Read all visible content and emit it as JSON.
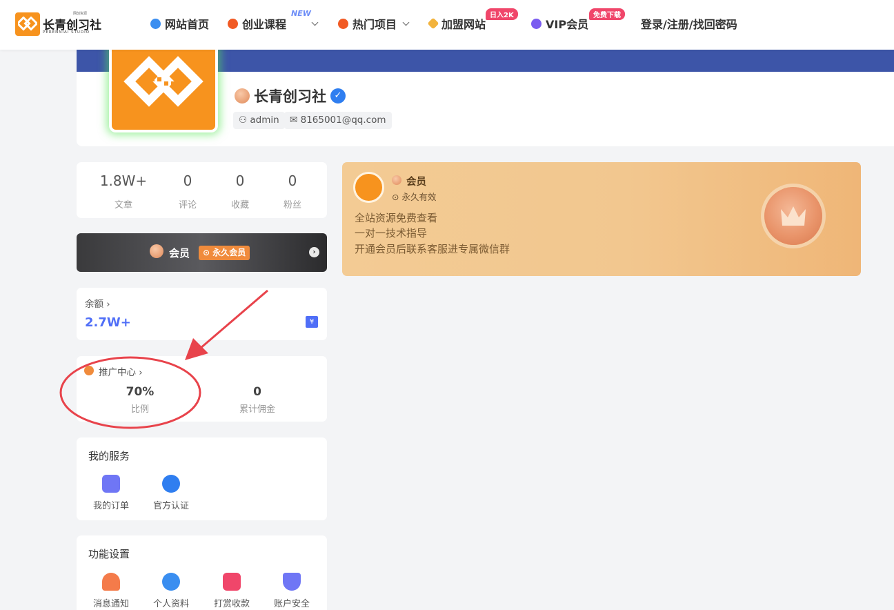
{
  "header": {
    "logo": {
      "name": "长青创习社",
      "english": "PERENNIAI STUDIO",
      "tiny": "网创资源"
    },
    "nav": [
      {
        "label": "网站首页",
        "icon": "home-icon"
      },
      {
        "label": "创业课程",
        "icon": "fire-icon",
        "badge": "NEW",
        "dropdown": true
      },
      {
        "label": "热门项目",
        "icon": "fire-icon",
        "dropdown": true
      },
      {
        "label": "加盟网站",
        "icon": "tag-icon",
        "badge": "日入2K"
      },
      {
        "label": "VIP会员",
        "icon": "vip-icon",
        "badge": "免费下载"
      },
      {
        "label": "登录/注册/找回密码"
      }
    ]
  },
  "profile": {
    "name": "长青创习社",
    "username": "admin",
    "email": "8165001@qq.com",
    "banner_color": "#3d55a8"
  },
  "stats": [
    {
      "value": "1.8W+",
      "label": "文章"
    },
    {
      "value": "0",
      "label": "评论"
    },
    {
      "value": "0",
      "label": "收藏"
    },
    {
      "value": "0",
      "label": "粉丝"
    }
  ],
  "vip_bar": {
    "label": "会员",
    "tag": "永久会员"
  },
  "balance": {
    "label": "余额",
    "value": "2.7W+",
    "icon": "wallet-icon"
  },
  "promo": {
    "title": "推广中心",
    "ratio_value": "70%",
    "ratio_label": "比例",
    "commission_value": "0",
    "commission_label": "累计佣金"
  },
  "services": {
    "title": "我的服务",
    "items": [
      {
        "label": "我的订单",
        "icon": "order-icon"
      },
      {
        "label": "官方认证",
        "icon": "verified-icon"
      }
    ]
  },
  "settings": {
    "title": "功能设置",
    "items": [
      {
        "label": "消息通知",
        "icon": "bell-icon"
      },
      {
        "label": "个人资料",
        "icon": "profile-icon"
      },
      {
        "label": "打赏收款",
        "icon": "gift-icon"
      },
      {
        "label": "账户安全",
        "icon": "shield-icon"
      }
    ]
  },
  "member_card": {
    "title": "会员",
    "validity": "永久有效",
    "benefits": [
      "全站资源免费查看",
      "一对一技术指导",
      "开通会员后联系客服进专属微信群"
    ]
  },
  "colors": {
    "accent": "#f7931e",
    "link_blue": "#4f6ef7",
    "annotation_red": "#e8434b"
  }
}
